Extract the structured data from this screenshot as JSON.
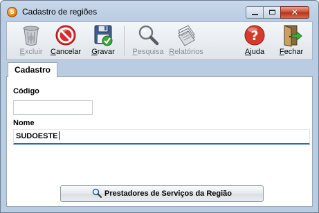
{
  "window": {
    "title": "Cadastro de regiões"
  },
  "toolbar": {
    "buttons": [
      {
        "label": "Excluir",
        "enabled": false,
        "icon": "trash-icon"
      },
      {
        "label": "Cancelar",
        "enabled": true,
        "icon": "cancel-icon"
      },
      {
        "label": "Gravar",
        "enabled": true,
        "icon": "save-icon"
      },
      {
        "label": "Pesquisa",
        "enabled": false,
        "icon": "search-icon"
      },
      {
        "label": "Relatórios",
        "enabled": false,
        "icon": "reports-icon"
      },
      {
        "label": "Ajuda",
        "enabled": true,
        "icon": "help-icon"
      },
      {
        "label": "Fechar",
        "enabled": true,
        "icon": "exit-door-icon"
      }
    ]
  },
  "tabs": [
    {
      "label": "Cadastro",
      "active": true
    }
  ],
  "form": {
    "codigo": {
      "label": "Código",
      "value": ""
    },
    "nome": {
      "label": "Nome",
      "value": "SUDOESTE"
    }
  },
  "actions": {
    "prestadores_label": "Prestadores de Serviços da Região"
  },
  "colors": {
    "accent": "#2b6cb0",
    "close_button": "#c8462c"
  }
}
